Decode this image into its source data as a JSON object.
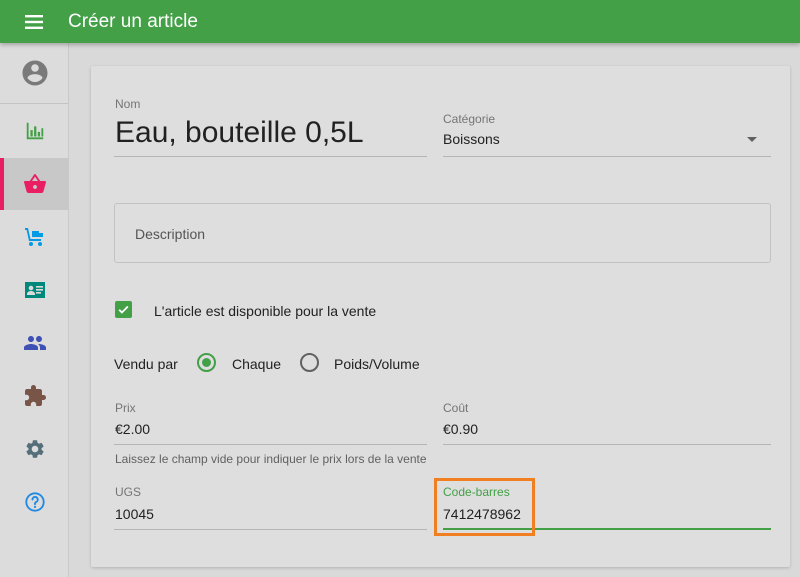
{
  "appbar": {
    "title": "Créer un article",
    "menu_icon": "hamburger-menu-icon"
  },
  "sidebar": {
    "items": [
      {
        "name": "account",
        "icon": "account-circle-icon",
        "color": "#7a7a7a"
      },
      {
        "name": "reports",
        "icon": "bar-chart-icon",
        "color": "#43a047"
      },
      {
        "name": "items",
        "icon": "shopping-basket-icon",
        "color": "#e91e63",
        "active": true
      },
      {
        "name": "inventory",
        "icon": "hand-truck-icon",
        "color": "#039be5"
      },
      {
        "name": "customers",
        "icon": "contact-card-icon",
        "color": "#00897b"
      },
      {
        "name": "employees",
        "icon": "people-icon",
        "color": "#3f51b5"
      },
      {
        "name": "apps",
        "icon": "puzzle-piece-icon",
        "color": "#795548"
      },
      {
        "name": "settings",
        "icon": "gear-icon",
        "color": "#546e7a"
      },
      {
        "name": "help",
        "icon": "help-circle-icon",
        "color": "#1e88e5"
      }
    ]
  },
  "form": {
    "name": {
      "label": "Nom",
      "value": "Eau, bouteille 0,5L"
    },
    "category": {
      "label": "Catégorie",
      "value": "Boissons"
    },
    "description": {
      "placeholder": "Description",
      "value": ""
    },
    "available": {
      "label": "L'article est disponible pour la vente",
      "checked": true
    },
    "sold_by": {
      "label": "Vendu par",
      "options": [
        "Chaque",
        "Poids/Volume"
      ],
      "selected": "Chaque"
    },
    "price": {
      "label": "Prix",
      "value": "€2.00",
      "hint": "Laissez le champ vide pour indiquer le prix lors de la vente"
    },
    "cost": {
      "label": "Coût",
      "value": "€0.90"
    },
    "sku": {
      "label": "UGS",
      "value": "10045"
    },
    "barcode": {
      "label": "Code-barres",
      "value": "7412478962"
    }
  },
  "colors": {
    "accent": "#43a047",
    "active_indicator": "#e91e63",
    "highlight": "#f07f22"
  }
}
